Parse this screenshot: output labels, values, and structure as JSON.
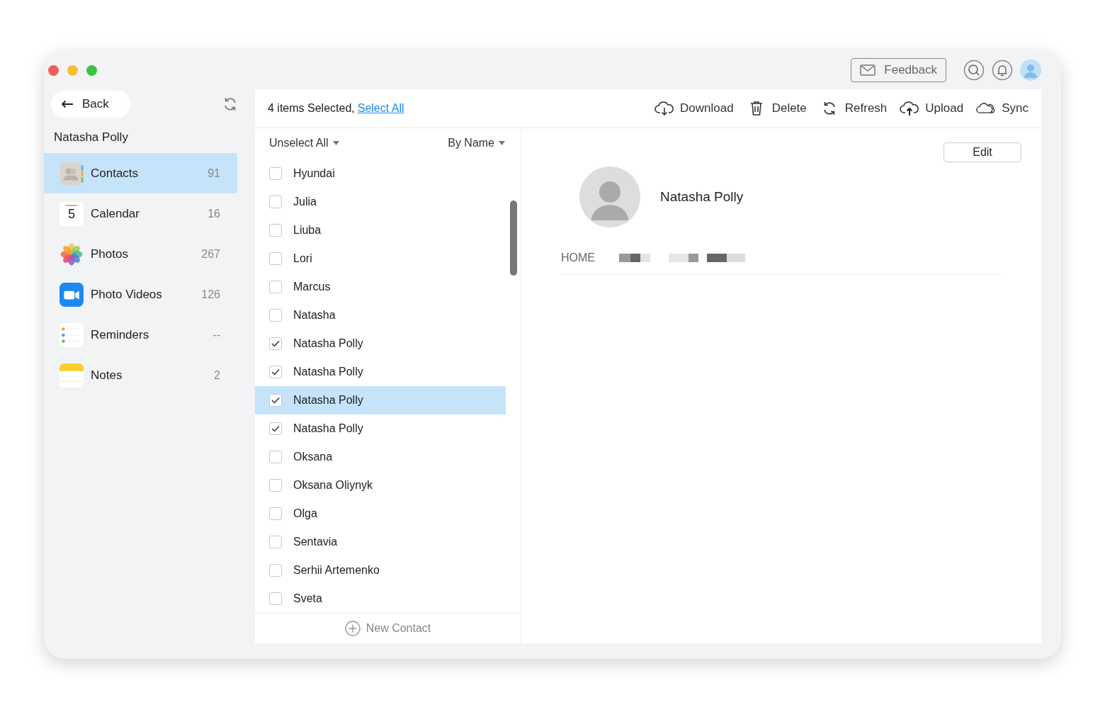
{
  "header": {
    "feedback": "Feedback"
  },
  "sidebar": {
    "back": "Back",
    "device": "Natasha Polly",
    "items": [
      {
        "kind": "contacts",
        "label": "Contacts",
        "count": "91",
        "selected": true
      },
      {
        "kind": "calendar",
        "label": "Calendar",
        "count": "16",
        "selected": false,
        "icon_text": "5"
      },
      {
        "kind": "photos",
        "label": "Photos",
        "count": "267",
        "selected": false
      },
      {
        "kind": "videos",
        "label": "Photo Videos",
        "count": "126",
        "selected": false
      },
      {
        "kind": "reminders",
        "label": "Reminders",
        "count": "--",
        "selected": false
      },
      {
        "kind": "notes",
        "label": "Notes",
        "count": "2",
        "selected": false
      }
    ]
  },
  "toolbar": {
    "selection": "4 items Selected,",
    "select_all": "Select All",
    "actions": [
      {
        "kind": "download",
        "label": "Download"
      },
      {
        "kind": "delete",
        "label": "Delete"
      },
      {
        "kind": "refresh",
        "label": "Refresh"
      },
      {
        "kind": "upload",
        "label": "Upload"
      },
      {
        "kind": "sync",
        "label": "Sync"
      }
    ]
  },
  "list": {
    "unselect": "Unselect All",
    "sort": "By Name",
    "contacts": [
      {
        "name": "Hyundai",
        "checked": false,
        "selected": false
      },
      {
        "name": "Julia",
        "checked": false,
        "selected": false
      },
      {
        "name": "Liuba",
        "checked": false,
        "selected": false
      },
      {
        "name": "Lori",
        "checked": false,
        "selected": false
      },
      {
        "name": "Marcus",
        "checked": false,
        "selected": false
      },
      {
        "name": "Natasha",
        "checked": false,
        "selected": false
      },
      {
        "name": "Natasha Polly",
        "checked": true,
        "selected": false
      },
      {
        "name": "Natasha Polly",
        "checked": true,
        "selected": false
      },
      {
        "name": "Natasha Polly",
        "checked": true,
        "selected": true
      },
      {
        "name": "Natasha Polly",
        "checked": true,
        "selected": false
      },
      {
        "name": "Oksana",
        "checked": false,
        "selected": false
      },
      {
        "name": "Oksana Oliynyk",
        "checked": false,
        "selected": false
      },
      {
        "name": "Olga",
        "checked": false,
        "selected": false
      },
      {
        "name": "Sentavia",
        "checked": false,
        "selected": false
      },
      {
        "name": "Serhii Artemenko",
        "checked": false,
        "selected": false
      },
      {
        "name": "Sveta",
        "checked": false,
        "selected": false
      }
    ],
    "new_contact": "New Contact"
  },
  "detail": {
    "edit": "Edit",
    "name": "Natasha Polly",
    "fields": [
      {
        "label": "HOME"
      }
    ]
  }
}
